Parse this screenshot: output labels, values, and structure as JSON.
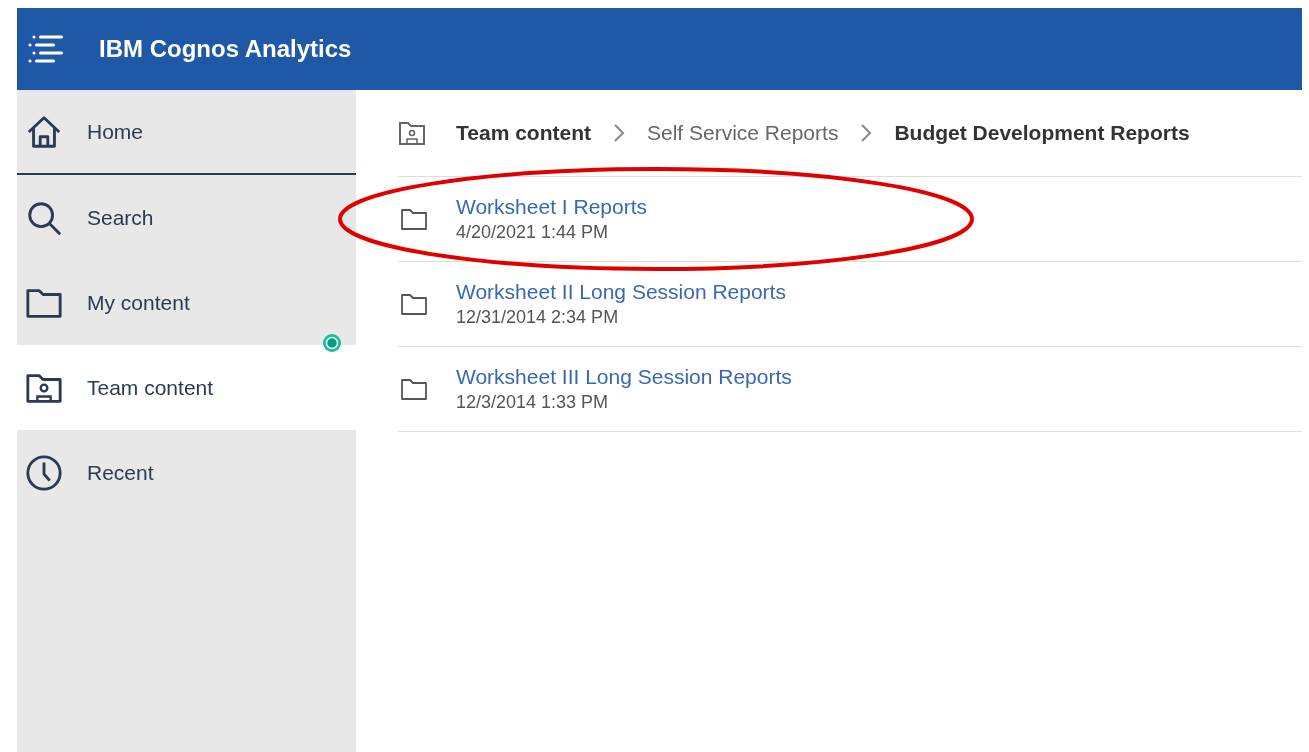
{
  "header": {
    "title": "IBM Cognos Analytics"
  },
  "sidebar": {
    "items": [
      {
        "label": "Home",
        "selected": false
      },
      {
        "label": "Search",
        "selected": false
      },
      {
        "label": "My content",
        "selected": false
      },
      {
        "label": "Team content",
        "selected": true
      },
      {
        "label": "Recent",
        "selected": false
      }
    ]
  },
  "breadcrumb": [
    {
      "label": "Team content",
      "bold": true
    },
    {
      "label": "Self Service Reports",
      "bold": false
    },
    {
      "label": "Budget Development Reports",
      "bold": true
    }
  ],
  "items": [
    {
      "name": "Worksheet I Reports",
      "modified": "4/20/2021 1:44 PM",
      "circled": true
    },
    {
      "name": "Worksheet II Long Session Reports",
      "modified": "12/31/2014 2:34 PM",
      "circled": false
    },
    {
      "name": "Worksheet III Long Session Reports",
      "modified": "12/3/2014 1:33 PM",
      "circled": false
    }
  ]
}
